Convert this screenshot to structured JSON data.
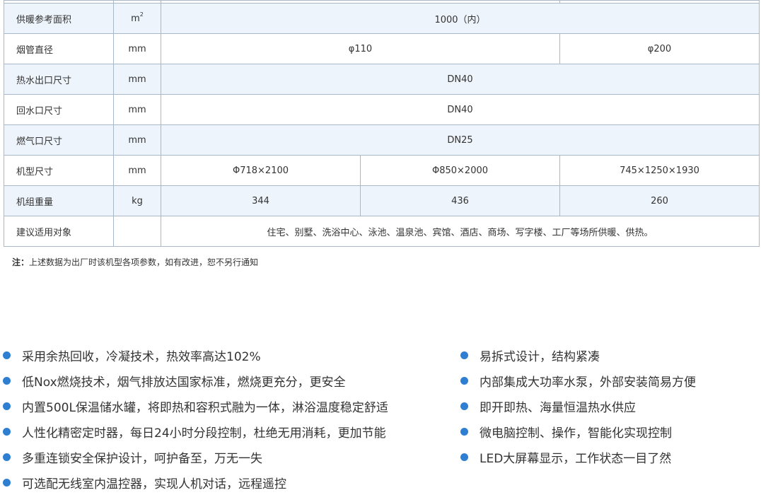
{
  "table": {
    "rows": [
      {
        "name": "供暖参考面积",
        "unit": "m",
        "unit_sup": "2",
        "values": [
          "1000（内）"
        ]
      },
      {
        "name": "烟管直径",
        "unit": "mm",
        "values": [
          "φ110",
          "φ200"
        ]
      },
      {
        "name": "热水出口尺寸",
        "unit": "mm",
        "values": [
          "DN40"
        ]
      },
      {
        "name": "回水口尺寸",
        "unit": "mm",
        "values": [
          "DN40"
        ]
      },
      {
        "name": "燃气口尺寸",
        "unit": "mm",
        "values": [
          "DN25"
        ]
      },
      {
        "name": "机型尺寸",
        "unit": "mm",
        "values": [
          "Φ718×2100",
          "Φ850×2000",
          "745×1250×1930"
        ]
      },
      {
        "name": "机组重量",
        "unit": "kg",
        "values": [
          "344",
          "436",
          "260"
        ]
      },
      {
        "name": "建议适用对象",
        "unit": "",
        "values": [
          "住宅、别墅、洗浴中心、泳池、温泉池、宾馆、酒店、商场、写字楼、工厂等场所供暖、供热。"
        ]
      }
    ]
  },
  "note": {
    "label": "注：",
    "text": "上述数据为出厂时该机型各项参数，如有改进，恕不另行通知"
  },
  "features": {
    "left": [
      "采用余热回收，冷凝技术，热效率高达102%",
      "低Nox燃烧技术，烟气排放达国家标准，燃烧更充分，更安全",
      "内置500L保温储水罐，将即热和容积式融为一体，淋浴温度稳定舒适",
      "人性化精密定时器，每日24小时分段控制，杜绝无用消耗，更加节能",
      "多重连锁安全保护设计，呵护备至，万无一失",
      "可选配无线室内温控器，实现人机对话，远程遥控"
    ],
    "right": [
      "易拆式设计，结构紧凑",
      "内部集成大功率水泵，外部安装简易方便",
      "即开即热、海量恒温热水供应",
      "微电脑控制、操作，智能化实现控制",
      "LED大屏幕显示，工作状态一目了然"
    ]
  },
  "colors": {
    "table_border": "#a9b8c9",
    "row_shade": "#eef4fb",
    "bullet": "#2e7fd2"
  }
}
